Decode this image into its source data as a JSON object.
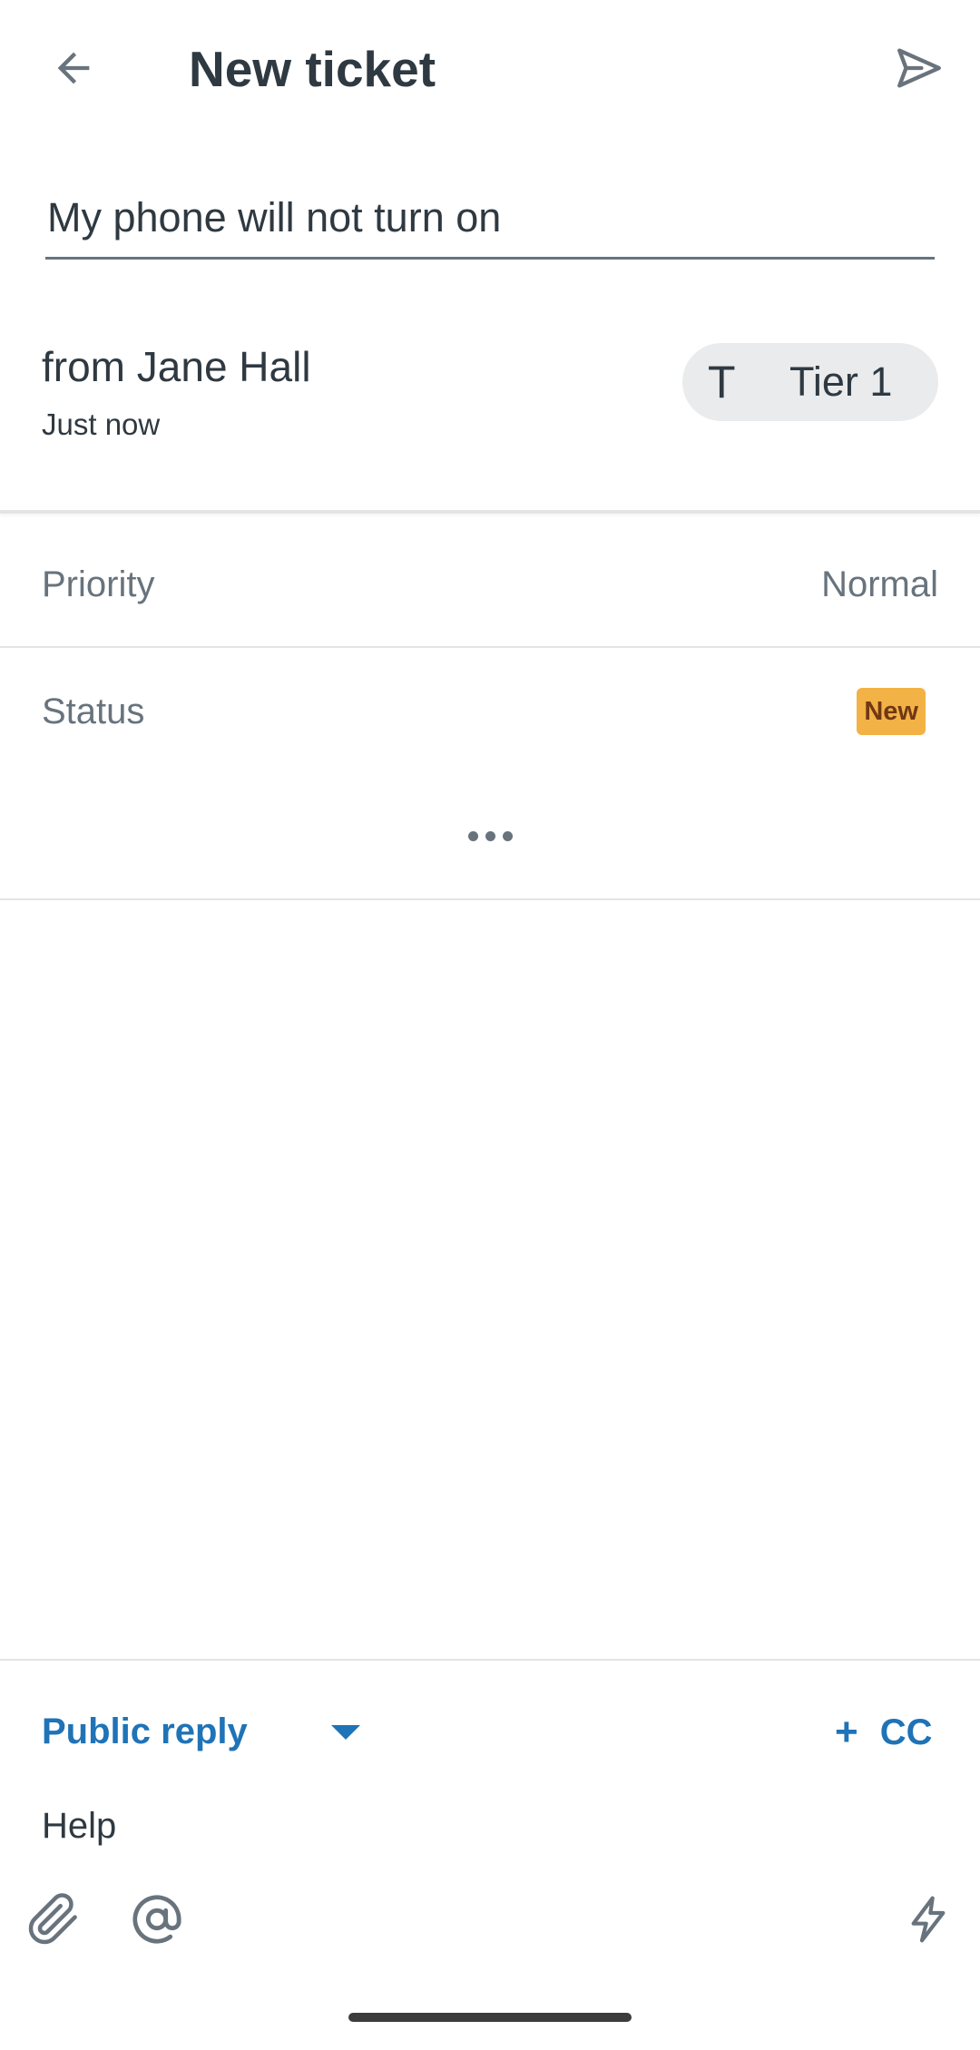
{
  "appbar": {
    "title": "New ticket",
    "back_icon": "arrow-left-icon",
    "send_icon": "send-icon"
  },
  "subject": {
    "value": "My phone will not turn on"
  },
  "requester": {
    "name": "from Jane Hall",
    "time": "Just now"
  },
  "group_chip": {
    "avatar_letter": "T",
    "label": "Tier 1"
  },
  "fields": {
    "priority_label": "Priority",
    "priority_value": "Normal",
    "status_label": "Status",
    "status_value": "New"
  },
  "more_icon": "more-horizontal-icon",
  "reply": {
    "type_label": "Public reply",
    "cc_label": "CC",
    "cc_plus": "+",
    "text": "Help"
  },
  "toolbar_icons": [
    "paperclip-icon",
    "at-sign-icon",
    "lightning-icon"
  ],
  "colors": {
    "accent": "#1f73b7",
    "status_new_bg": "#f3b245",
    "status_new_text": "#703815",
    "text_primary": "#2f3941",
    "text_secondary": "#68737d"
  }
}
